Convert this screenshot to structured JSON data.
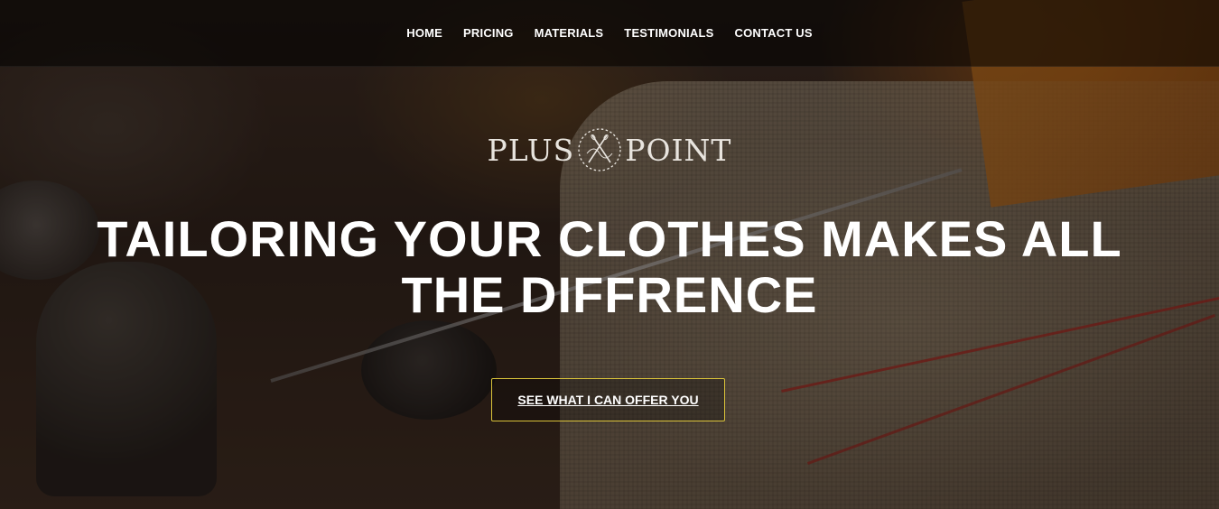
{
  "nav": {
    "items": [
      {
        "label": "HOME"
      },
      {
        "label": "PRICING"
      },
      {
        "label": "MATERIALS"
      },
      {
        "label": "TESTIMONIALS"
      },
      {
        "label": "CONTACT US"
      }
    ]
  },
  "logo": {
    "left": "PLUS",
    "right": "POINT",
    "emblem_icon": "crossed-needles-icon"
  },
  "hero": {
    "headline": "TAILORING YOUR CLOTHES MAKES ALL THE DIFFRENCE",
    "cta_label": "SEE WHAT I CAN OFFER YOU"
  },
  "colors": {
    "accent_border": "#d9c23a",
    "text": "#ffffff",
    "nav_bg": "rgba(0,0,0,0.55)"
  }
}
